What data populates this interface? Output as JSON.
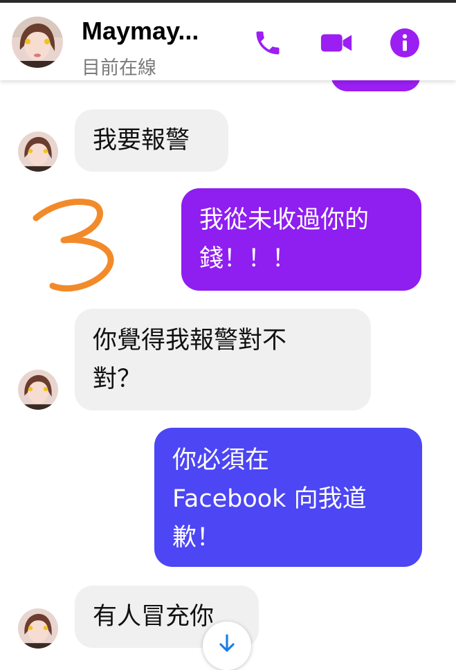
{
  "header": {
    "name": "Maymay...",
    "status": "目前在線",
    "icons": [
      "phone-icon",
      "video-icon",
      "info-icon"
    ],
    "accent_color": "#9b1ef2"
  },
  "messages": [
    {
      "sender": "contact",
      "text": "我要報警"
    },
    {
      "sender": "self",
      "lines": [
        "我從未收過你的",
        "錢！！！"
      ]
    },
    {
      "sender": "contact",
      "lines": [
        "你覺得我報警對不",
        "對？"
      ]
    },
    {
      "sender": "self",
      "lines": [
        "你必須在",
        "Facebook 向我道",
        "歉！"
      ]
    },
    {
      "sender": "contact",
      "text": "有人冒充你"
    }
  ],
  "annotation": {
    "text": "3",
    "color": "#f28a2a"
  },
  "colors": {
    "sent_purple": "#8f1ef0",
    "sent_blue": "#4c46f4",
    "received_bg": "#f0f0f0",
    "scroll_arrow": "#1a7ee8"
  }
}
